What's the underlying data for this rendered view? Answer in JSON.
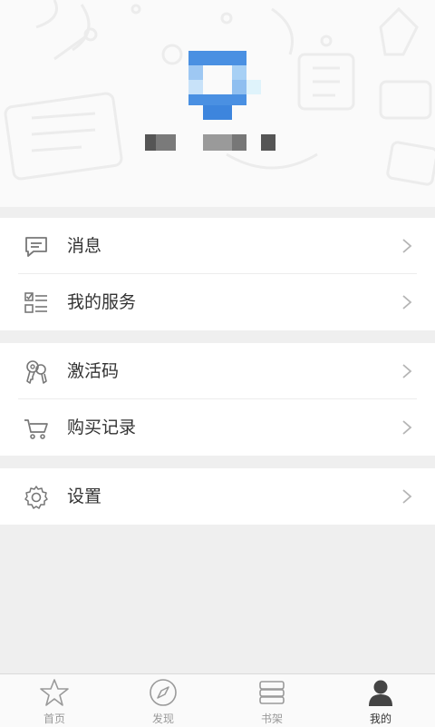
{
  "profile": {
    "avatar": "avatar-pixelated",
    "username": ""
  },
  "menu": {
    "group1": [
      {
        "label": "消息",
        "icon": "message-icon"
      },
      {
        "label": "我的服务",
        "icon": "service-list-icon"
      }
    ],
    "group2": [
      {
        "label": "激活码",
        "icon": "keys-icon"
      },
      {
        "label": "购买记录",
        "icon": "cart-icon"
      }
    ],
    "group3": [
      {
        "label": "设置",
        "icon": "gear-icon"
      }
    ]
  },
  "tabbar": {
    "tabs": [
      {
        "label": "首页",
        "icon": "star-icon",
        "active": false
      },
      {
        "label": "发现",
        "icon": "compass-icon",
        "active": false
      },
      {
        "label": "书架",
        "icon": "bookshelf-icon",
        "active": false
      },
      {
        "label": "我的",
        "icon": "user-icon",
        "active": true
      }
    ]
  },
  "colors": {
    "accent": "#4a90e2",
    "text": "#333333",
    "muted": "#999999",
    "background": "#efefef"
  }
}
